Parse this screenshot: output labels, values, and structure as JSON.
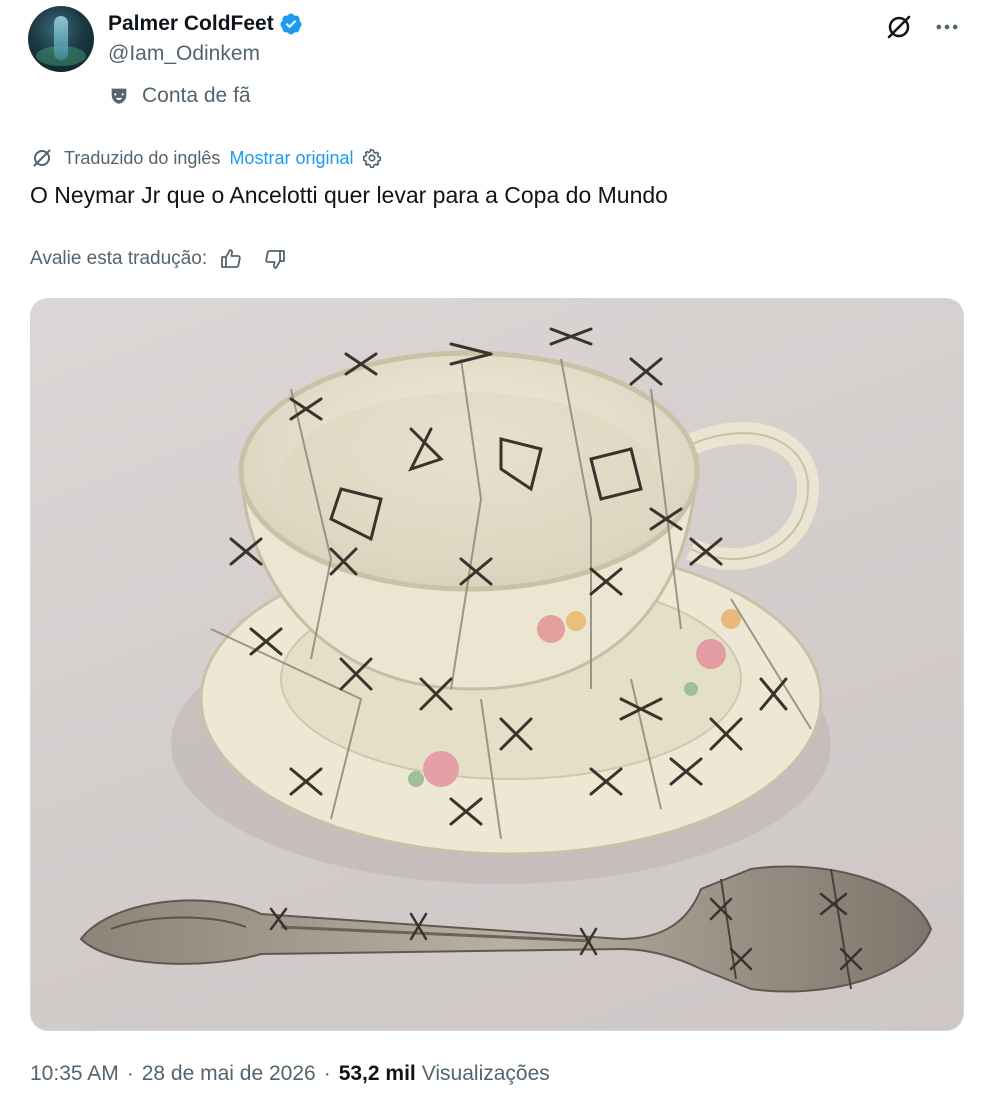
{
  "author": {
    "name": "Palmer ColdFeet",
    "handle": "@Iam_Odinkem",
    "label": "Conta de fã"
  },
  "translation": {
    "note": "Traduzido do inglês",
    "show_original": "Mostrar original"
  },
  "tweet": {
    "text": "O Neymar Jr que o Ancelotti quer levar para a Copa do Mundo"
  },
  "rating": {
    "prompt": "Avalie esta tradução:"
  },
  "meta": {
    "time": "10:35 AM",
    "date": "28 de mai de 2026",
    "views_count": "53,2 mil",
    "views_label": "Visualizações",
    "separator": "·"
  },
  "colors": {
    "accent": "#1d9bf0",
    "text": "#0f1419",
    "secondary": "#536471"
  },
  "icons": {
    "verified": "verified-badge-icon",
    "translate": "grok-translate-icon",
    "more": "more-dots-icon",
    "fan": "fan-mask-icon",
    "settings": "gear-icon",
    "like": "thumbs-up-icon",
    "dislike": "thumbs-down-icon"
  }
}
